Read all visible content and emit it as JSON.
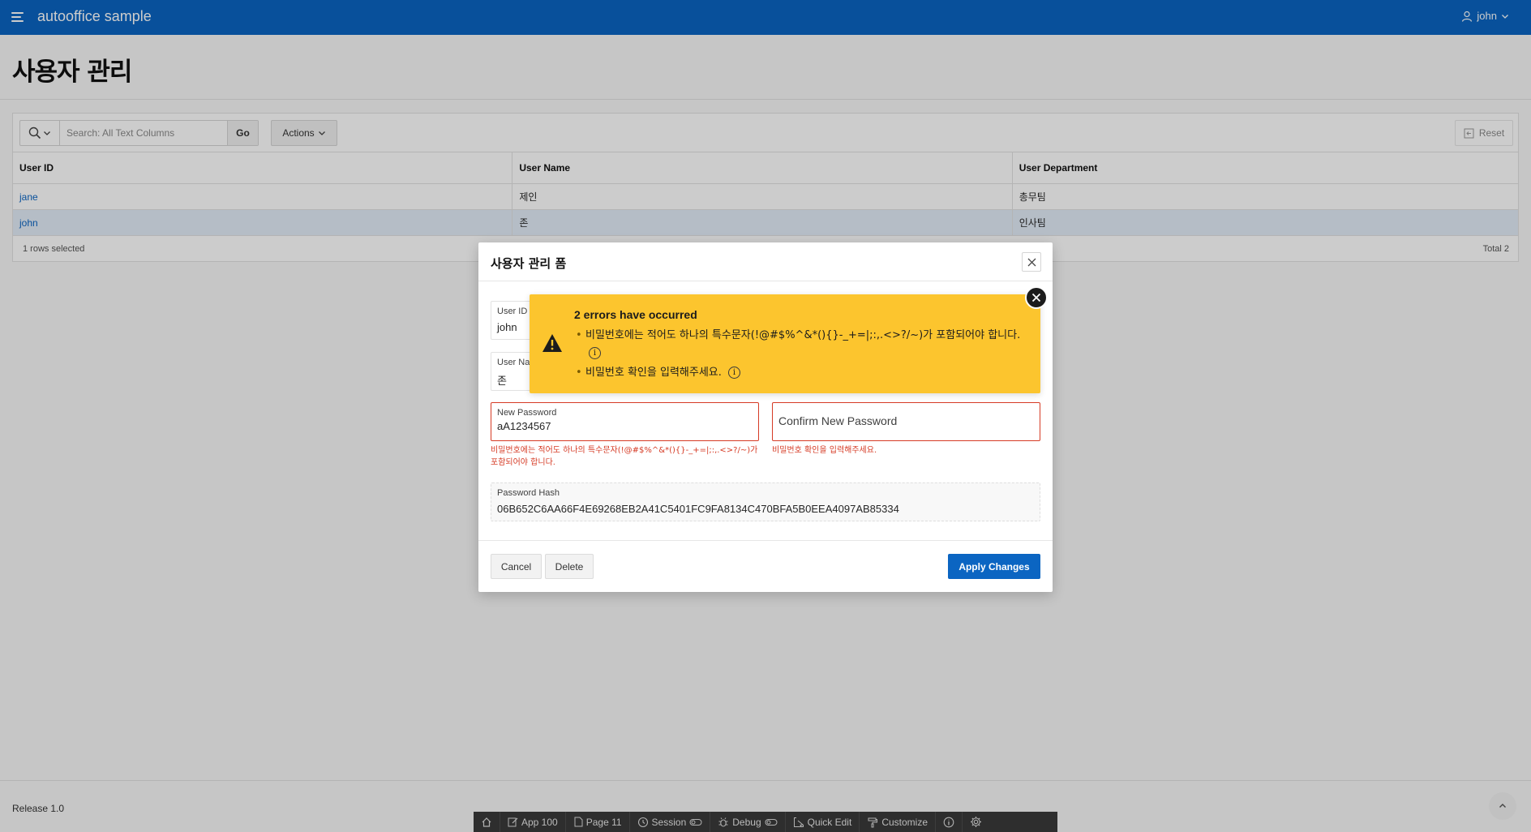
{
  "header": {
    "app_title": "autooffice sample",
    "user_name": "john"
  },
  "page": {
    "title": "사용자 관리"
  },
  "report": {
    "search_placeholder": "Search: All Text Columns",
    "go_label": "Go",
    "actions_label": "Actions",
    "reset_label": "Reset",
    "columns": [
      "User ID",
      "User Name",
      "User Department"
    ],
    "rows": [
      {
        "user_id": "jane",
        "user_name": "제인",
        "department": "총무팀",
        "selected": false
      },
      {
        "user_id": "john",
        "user_name": "존",
        "department": "인사팀",
        "selected": true
      }
    ],
    "selection_text": "1 rows selected",
    "total_text": "Total 2"
  },
  "footer": {
    "release": "Release 1.0"
  },
  "devbar": {
    "app": "App 100",
    "page": "Page 11",
    "session": "Session",
    "debug": "Debug",
    "quick_edit": "Quick Edit",
    "customize": "Customize"
  },
  "dialog": {
    "title": "사용자 관리 폼",
    "user_id_label": "User ID",
    "user_id_value": "john",
    "user_name_label": "User Na",
    "user_name_value": "존",
    "new_password_label": "New Password",
    "new_password_value": "aA1234567",
    "new_password_error_line1": "비밀번호에는 적어도 하나의 특수문자(!@#$%^&*(){}-_+=|;:,.<>?/~)가",
    "new_password_error_line2": "포함되어야 합니다.",
    "confirm_password_placeholder": "Confirm New Password",
    "confirm_password_error": "비밀번호 확인을 입력해주세요.",
    "password_hash_label": "Password Hash",
    "password_hash_value": "06B652C6AA66F4E69268EB2A41C5401FC9FA8134C470BFA5B0EEA4097AB85334",
    "cancel_label": "Cancel",
    "delete_label": "Delete",
    "apply_label": "Apply Changes"
  },
  "alert": {
    "heading": "2 errors have occurred",
    "errors": [
      "비밀번호에는 적어도 하나의 특수문자(!@#$%^&*(){}-_+=|;:,.<>?/~)가 포함되어야 합니다.",
      "비밀번호 확인을 입력해주세요."
    ],
    "color": "#fcc52e"
  },
  "colors": {
    "brand": "#0b65c2",
    "error": "#d63b25",
    "warning": "#fcc52e"
  }
}
